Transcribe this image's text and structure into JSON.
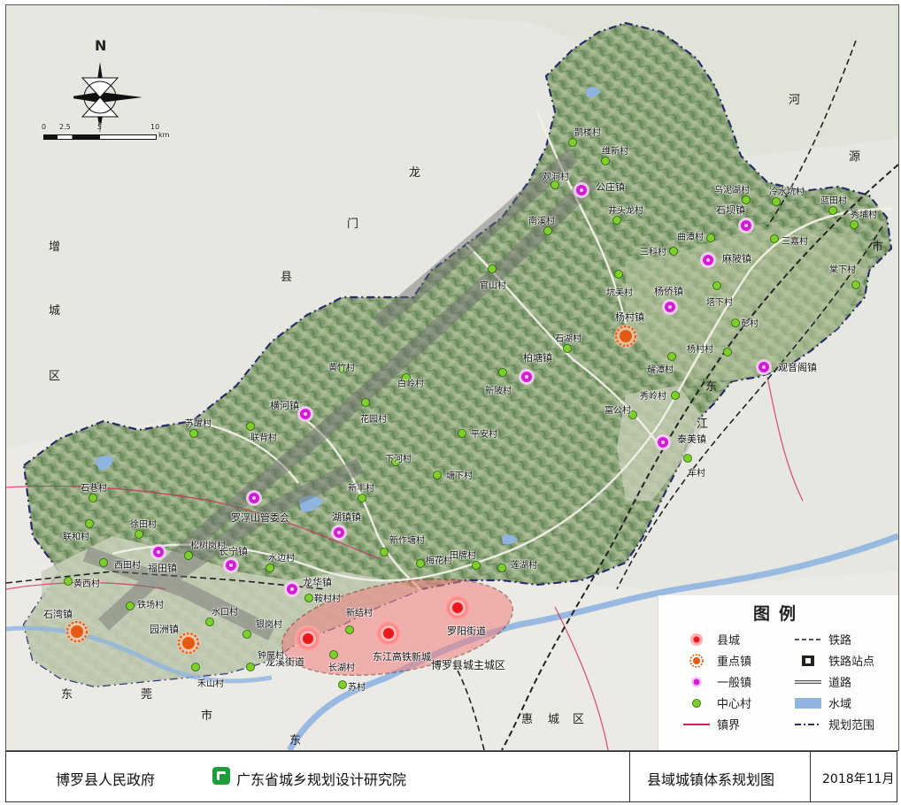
{
  "map": {
    "north_label": "N",
    "scale_ticks": [
      "0",
      "2.5",
      "5",
      "10"
    ],
    "scale_unit": "km",
    "area_labels": [
      "龙",
      "门",
      "县",
      "增",
      "城",
      "区",
      "河",
      "源",
      "市",
      "东",
      "江",
      "东",
      "莞",
      "市",
      "惠",
      "城",
      "区",
      "东"
    ],
    "towns": {
      "county": [
        {
          "name": "龙溪街道"
        },
        {
          "name": "东江高铁新城"
        },
        {
          "name": "罗阳街道"
        }
      ],
      "key_towns": [
        {
          "name": "杨村镇"
        },
        {
          "name": "石湾镇"
        },
        {
          "name": "园洲镇"
        }
      ],
      "general_towns": [
        {
          "name": "公庄镇"
        },
        {
          "name": "石坝镇"
        },
        {
          "name": "麻陂镇"
        },
        {
          "name": "杨侨镇"
        },
        {
          "name": "观音阁镇"
        },
        {
          "name": "柏塘镇"
        },
        {
          "name": "横河镇"
        },
        {
          "name": "泰美镇"
        },
        {
          "name": "罗浮山管委会"
        },
        {
          "name": "湖镇镇"
        },
        {
          "name": "长宁镇"
        },
        {
          "name": "福田镇"
        },
        {
          "name": "龙华镇"
        }
      ],
      "villages": [
        {
          "name": "鹊楼村"
        },
        {
          "name": "维新村"
        },
        {
          "name": "观洞村"
        },
        {
          "name": "南溪村"
        },
        {
          "name": "井头龙村"
        },
        {
          "name": "乌泥湖村"
        },
        {
          "name": "冷水坑村"
        },
        {
          "name": "蓝田村"
        },
        {
          "name": "秀埔村"
        },
        {
          "name": "曲潭村"
        },
        {
          "name": "三嘉村"
        },
        {
          "name": "三科村"
        },
        {
          "name": "棠下村"
        },
        {
          "name": "坑美村"
        },
        {
          "name": "塔下村"
        },
        {
          "name": "官山村"
        },
        {
          "name": "彭村"
        },
        {
          "name": "石湖村"
        },
        {
          "name": "杨村村"
        },
        {
          "name": "耀潭村"
        },
        {
          "name": "新陂村"
        },
        {
          "name": "秀岭村"
        },
        {
          "name": "黄竹村"
        },
        {
          "name": "白岭村"
        },
        {
          "name": "富公村"
        },
        {
          "name": "花园村"
        },
        {
          "name": "苏醒村"
        },
        {
          "name": "联背村"
        },
        {
          "name": "平安村"
        },
        {
          "name": "车村"
        },
        {
          "name": "下河村"
        },
        {
          "name": "石巷村"
        },
        {
          "name": "塘下村"
        },
        {
          "name": "新丰村"
        },
        {
          "name": "联和村"
        },
        {
          "name": "徐田村"
        },
        {
          "name": "松树岗村"
        },
        {
          "name": "新作塘村"
        },
        {
          "name": "田牌村"
        },
        {
          "name": "莲湖村"
        },
        {
          "name": "西田村"
        },
        {
          "name": "水边村"
        },
        {
          "name": "梅花村"
        },
        {
          "name": "黄西村"
        },
        {
          "name": "鞍村村"
        },
        {
          "name": "铁场村"
        },
        {
          "name": "水口村"
        },
        {
          "name": "新结村"
        },
        {
          "name": "银岗村"
        },
        {
          "name": "长湖村"
        },
        {
          "name": "钟屋村"
        },
        {
          "name": "禾山村"
        },
        {
          "name": "苏村"
        }
      ]
    },
    "district_label": "博罗县城主城区"
  },
  "legend": {
    "title": "图例",
    "items": [
      {
        "label": "县城"
      },
      {
        "label": "铁路"
      },
      {
        "label": "重点镇"
      },
      {
        "label": "铁路站点"
      },
      {
        "label": "一般镇"
      },
      {
        "label": "道路"
      },
      {
        "label": "中心村"
      },
      {
        "label": "水域"
      },
      {
        "label": "镇界"
      },
      {
        "label": "规划范围"
      }
    ],
    "colors": {
      "county": "#e8181c",
      "key_town": "#e35a14",
      "general_town": "#d41bd8",
      "village": "#7dd02a",
      "boundary": "#d2245a",
      "water": "#8fb4e0"
    }
  },
  "footer": {
    "government": "博罗县人民政府",
    "institute": "广东省城乡规划设计研究院",
    "map_title": "县域城镇体系规划图",
    "date": "2018年11月"
  }
}
